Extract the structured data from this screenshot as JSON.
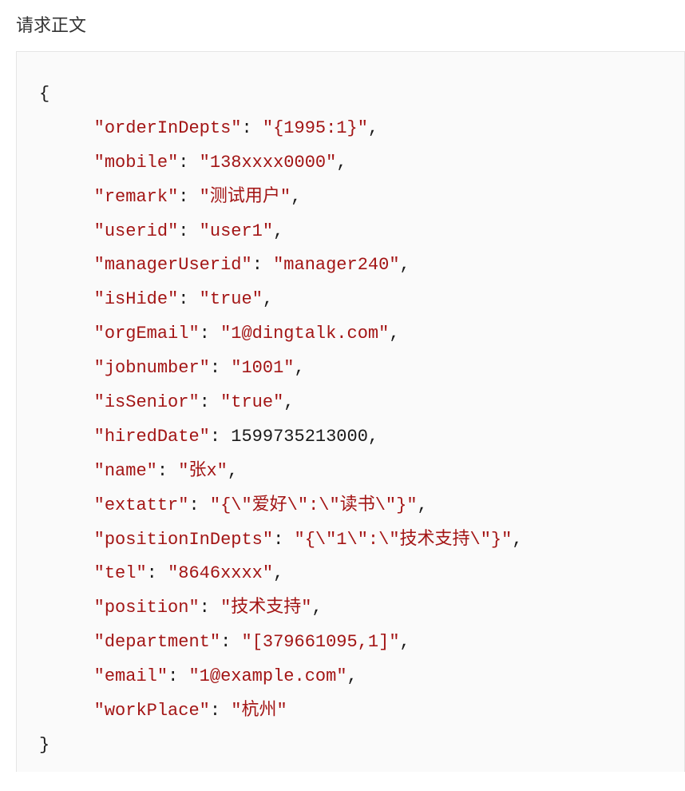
{
  "title": "请求正文",
  "braces": {
    "open": "{",
    "close": "}"
  },
  "entries": [
    {
      "key": "orderInDepts",
      "value": "{1995:1}",
      "type": "string"
    },
    {
      "key": "mobile",
      "value": "138xxxx0000",
      "type": "string"
    },
    {
      "key": "remark",
      "value": "测试用户",
      "type": "string"
    },
    {
      "key": "userid",
      "value": "user1",
      "type": "string"
    },
    {
      "key": "managerUserid",
      "value": "manager240",
      "type": "string"
    },
    {
      "key": "isHide",
      "value": "true",
      "type": "string"
    },
    {
      "key": "orgEmail",
      "value": "1@dingtalk.com",
      "type": "string"
    },
    {
      "key": "jobnumber",
      "value": "1001",
      "type": "string"
    },
    {
      "key": "isSenior",
      "value": "true",
      "type": "string"
    },
    {
      "key": "hiredDate",
      "value": "1599735213000",
      "type": "number"
    },
    {
      "key": "name",
      "value": "张x",
      "type": "string"
    },
    {
      "key": "extattr",
      "value": "{\\\"爱好\\\":\\\"读书\\\"}",
      "type": "string"
    },
    {
      "key": "positionInDepts",
      "value": "{\\\"1\\\":\\\"技术支持\\\"}",
      "type": "string"
    },
    {
      "key": "tel",
      "value": "8646xxxx",
      "type": "string"
    },
    {
      "key": "position",
      "value": "技术支持",
      "type": "string"
    },
    {
      "key": "department",
      "value": "[379661095,1]",
      "type": "string"
    },
    {
      "key": "email",
      "value": "1@example.com",
      "type": "string"
    },
    {
      "key": "workPlace",
      "value": "杭州",
      "type": "string"
    }
  ]
}
